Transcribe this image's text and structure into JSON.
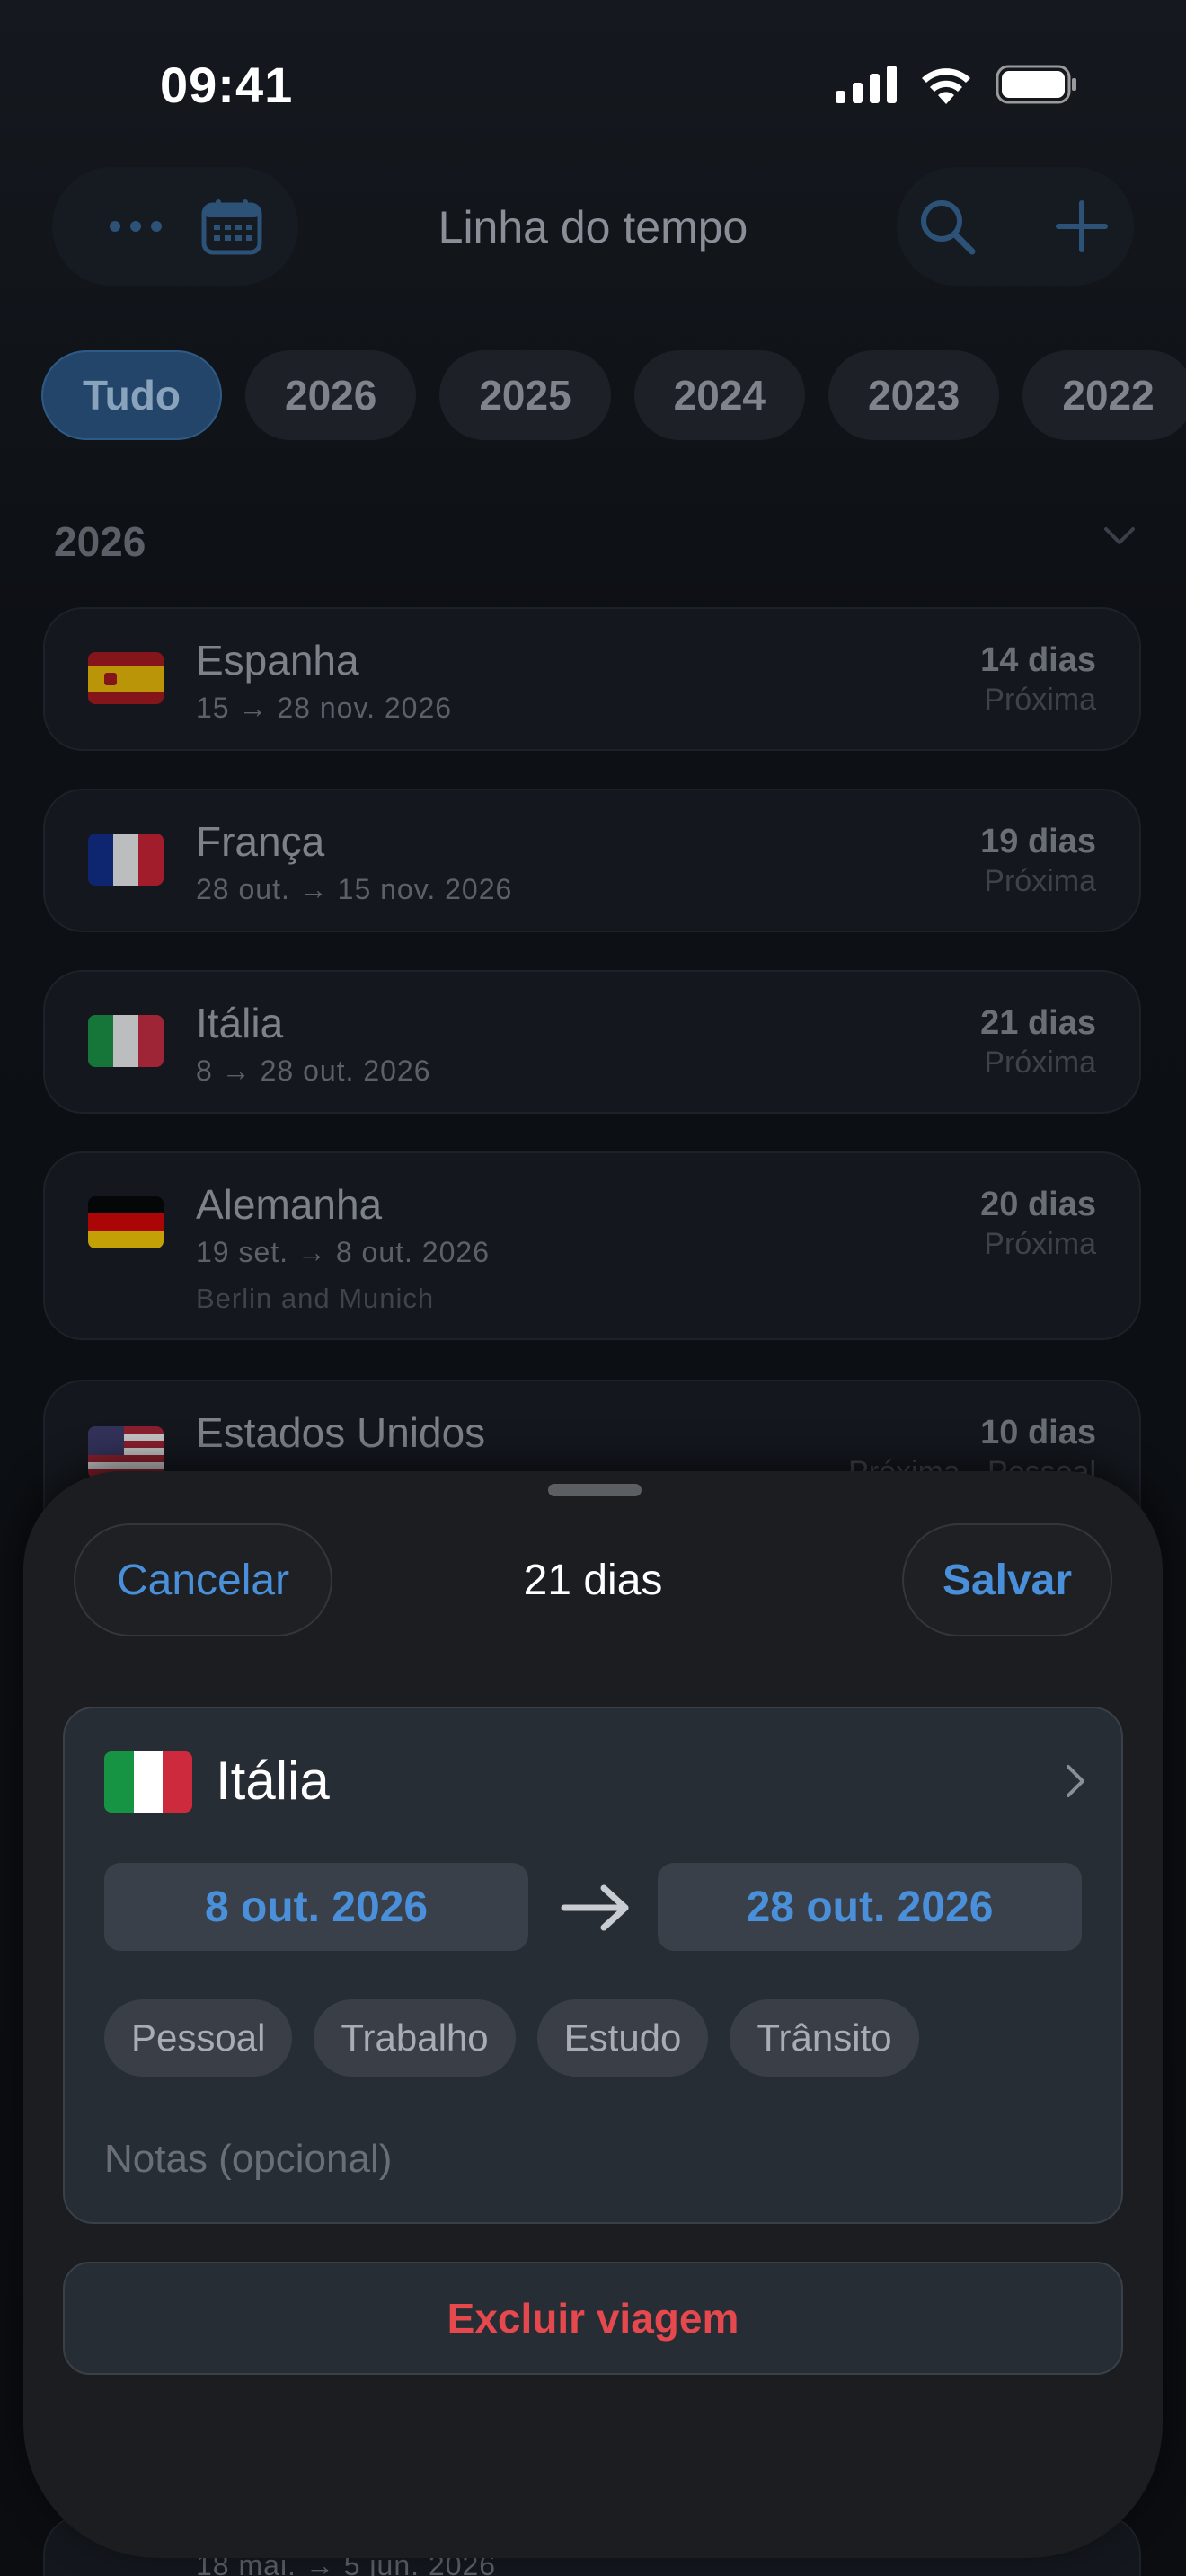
{
  "status_bar": {
    "time": "09:41"
  },
  "nav": {
    "title": "Linha do tempo"
  },
  "year_filters": [
    "Tudo",
    "2026",
    "2025",
    "2024",
    "2023",
    "2022"
  ],
  "section": {
    "year": "2026"
  },
  "trips": [
    {
      "name": "Espanha",
      "dates": "15 → 28 nov. 2026",
      "days": "14 dias",
      "status": "Próxima",
      "note": ""
    },
    {
      "name": "França",
      "dates": "28 out. → 15 nov. 2026",
      "days": "19 dias",
      "status": "Próxima",
      "note": ""
    },
    {
      "name": "Itália",
      "dates": "8 → 28 out. 2026",
      "days": "21 dias",
      "status": "Próxima",
      "note": ""
    },
    {
      "name": "Alemanha",
      "dates": "19 set. → 8 out. 2026",
      "days": "20 dias",
      "status": "Próxima",
      "note": "Berlin and Munich"
    },
    {
      "name": "Estados Unidos",
      "dates": "",
      "days": "10 dias",
      "status": "Próxima · Pessoal",
      "note": ""
    }
  ],
  "partial_bottom_row": {
    "dates": "18 mai. → 5 jun. 2026"
  },
  "sheet": {
    "cancel_label": "Cancelar",
    "title": "21 dias",
    "save_label": "Salvar",
    "country": "Itália",
    "start_date": "8 out. 2026",
    "end_date": "28 out. 2026",
    "tags": [
      "Pessoal",
      "Trabalho",
      "Estudo",
      "Trânsito"
    ],
    "notes_placeholder": "Notas (opcional)",
    "notes_value": "",
    "delete_label": "Excluir viagem"
  },
  "colors": {
    "accent": "#4a8fd9",
    "destructive": "#e5484d",
    "sheet_bg": "#1b1d21",
    "card_bg": "#272d35"
  },
  "icons": [
    "ellipsis-icon",
    "calendar-icon",
    "search-icon",
    "plus-icon",
    "chevron-down-icon",
    "chevron-right-icon",
    "arrow-right-icon"
  ]
}
